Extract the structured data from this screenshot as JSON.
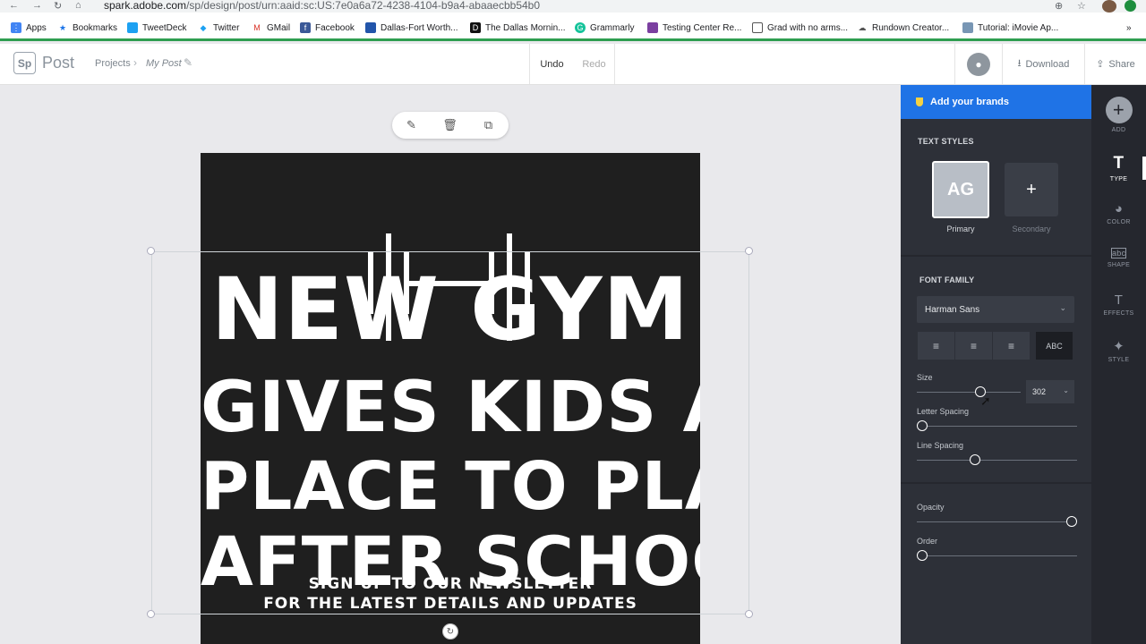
{
  "browser": {
    "url_host": "spark.adobe.com",
    "url_path": "/sp/design/post/urn:aaid:sc:US:7e0a6a72-4238-4104-b9a4-abaaecbb54b0",
    "bookmarks": [
      {
        "label": "Apps"
      },
      {
        "label": "Bookmarks"
      },
      {
        "label": "TweetDeck"
      },
      {
        "label": "Twitter"
      },
      {
        "label": "GMail"
      },
      {
        "label": "Facebook"
      },
      {
        "label": "Dallas-Fort Worth..."
      },
      {
        "label": "The Dallas Mornin..."
      },
      {
        "label": "Grammarly"
      },
      {
        "label": "Testing Center Re..."
      },
      {
        "label": "Grad with no arms..."
      },
      {
        "label": "Rundown Creator..."
      },
      {
        "label": "Tutorial: iMovie Ap..."
      }
    ]
  },
  "app": {
    "logo_mark": "Sp",
    "logo_name": "Post",
    "breadcrumb_projects": "Projects",
    "breadcrumb_sep": "›",
    "breadcrumb_current": "My Post",
    "undo": "Undo",
    "redo": "Redo",
    "download": "Download",
    "share": "Share"
  },
  "design": {
    "lines": [
      "NEW GYM",
      "GIVES KIDS A",
      "PLACE TO PLAY",
      "AFTER SCHOOL"
    ],
    "sub_lines": [
      "SIGN UP TO OUR NEWSLETTER",
      "FOR THE LATEST DETAILS AND UPDATES"
    ],
    "background": "#1f1f1f",
    "text_color": "#ffffff"
  },
  "panel": {
    "brands": "Add your brands",
    "text_styles_heading": "TEXT STYLES",
    "primary_sample": "AG",
    "primary_label": "Primary",
    "secondary_plus": "+",
    "secondary_label": "Secondary",
    "font_family_heading": "FONT FAMILY",
    "font_family": "Harman Sans",
    "size_label": "Size",
    "size_value": "302",
    "letter_spacing_label": "Letter Spacing",
    "line_spacing_label": "Line Spacing",
    "opacity_label": "Opacity",
    "order_label": "Order",
    "accent_color": "#1f73e6"
  },
  "rail": [
    {
      "label": "ADD"
    },
    {
      "label": "TYPE"
    },
    {
      "label": "COLOR"
    },
    {
      "label": "SHAPE"
    },
    {
      "label": "EFFECTS"
    },
    {
      "label": "STYLE"
    }
  ]
}
